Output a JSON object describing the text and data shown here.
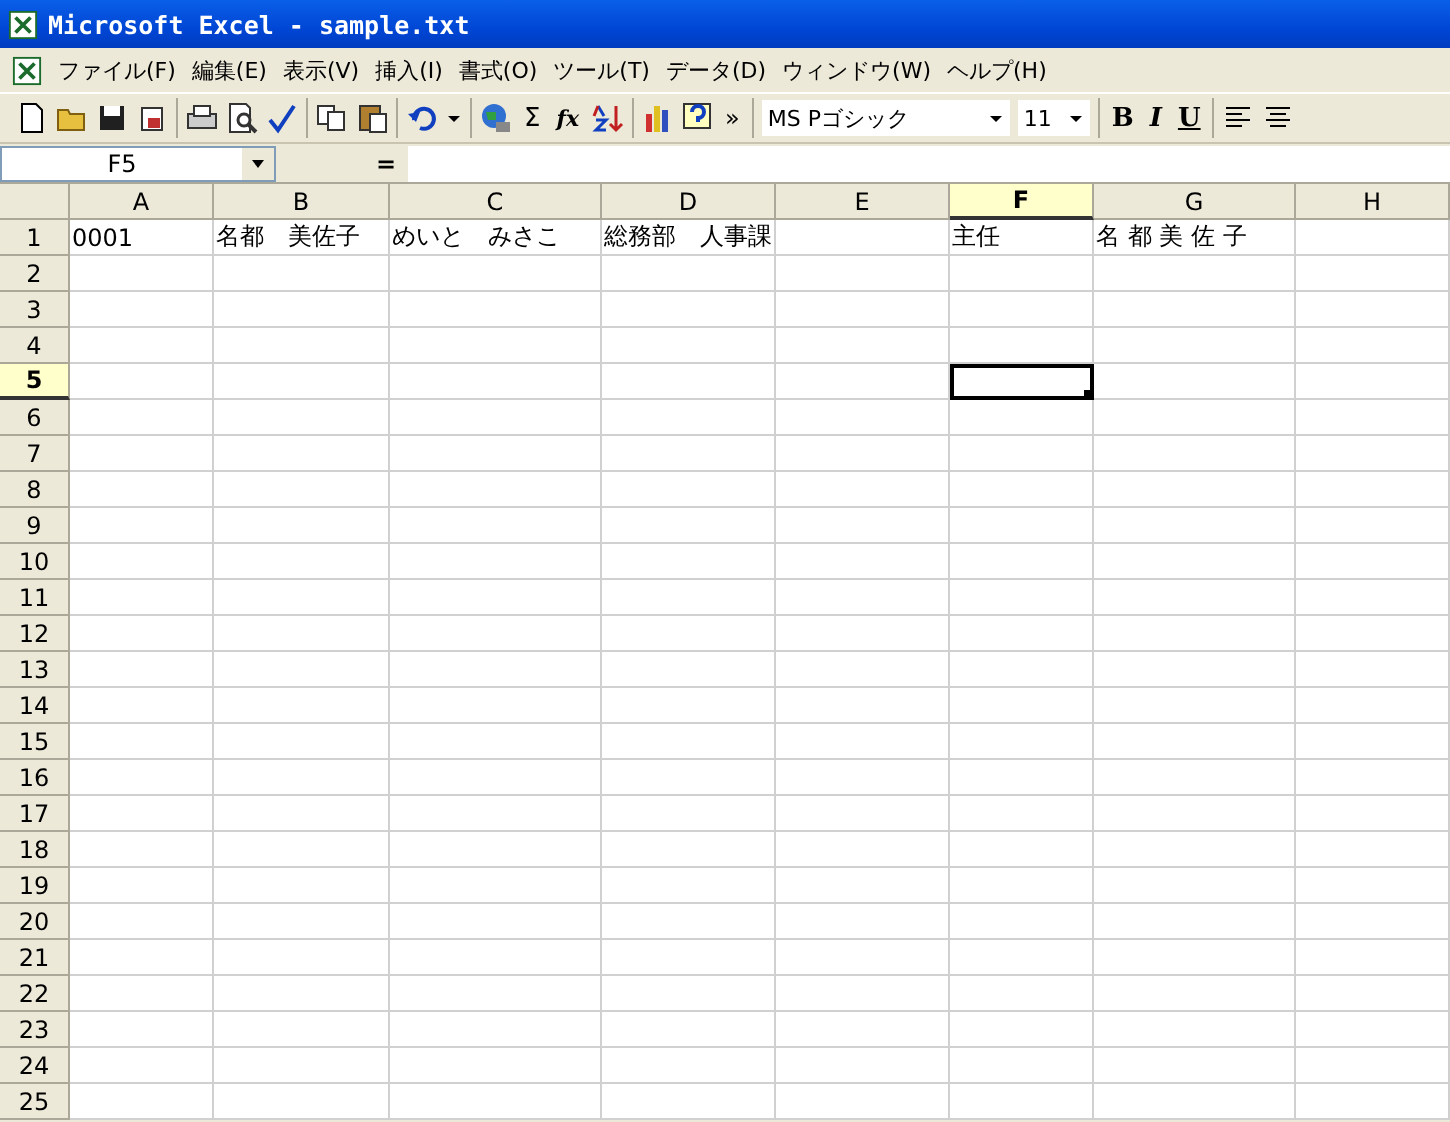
{
  "window": {
    "title": "Microsoft Excel - sample.txt"
  },
  "menu": [
    "ファイル(F)",
    "編集(E)",
    "表示(V)",
    "挿入(I)",
    "書式(O)",
    "ツール(T)",
    "データ(D)",
    "ウィンドウ(W)",
    "ヘルプ(H)"
  ],
  "toolbar": {
    "sum": "Σ",
    "function": "fx",
    "more": "»",
    "font": "MS Pゴシック",
    "size": "11",
    "bold": "B",
    "italic": "I",
    "underline": "U"
  },
  "formula_bar": {
    "name_box": "F5",
    "equals": "="
  },
  "sheet": {
    "columns": [
      {
        "label": "A",
        "selected": false
      },
      {
        "label": "B",
        "selected": false
      },
      {
        "label": "C",
        "selected": false
      },
      {
        "label": "D",
        "selected": false
      },
      {
        "label": "E",
        "selected": false
      },
      {
        "label": "F",
        "selected": true
      },
      {
        "label": "G",
        "selected": false
      },
      {
        "label": "H",
        "selected": false
      }
    ],
    "rows": [
      {
        "header": "1",
        "selected": false,
        "cells": [
          {
            "text": "0001",
            "active": false
          },
          {
            "text": "名都　美佐子",
            "active": false
          },
          {
            "text": "めいと　みさこ",
            "active": false
          },
          {
            "text": "総務部　人事課",
            "active": false
          },
          {
            "active": false
          },
          {
            "text": "主任",
            "active": false
          },
          {
            "text": "名 都 美 佐 子",
            "active": false
          },
          {
            "active": false
          }
        ]
      },
      {
        "header": "2",
        "selected": false
      },
      {
        "header": "3",
        "selected": false
      },
      {
        "header": "4",
        "selected": false
      },
      {
        "header": "5",
        "selected": true,
        "cells": [
          {
            "active": false
          },
          {
            "active": false
          },
          {
            "active": false
          },
          {
            "active": false
          },
          {
            "active": false
          },
          {
            "active": true
          },
          {
            "active": false
          },
          {
            "active": false
          }
        ]
      },
      {
        "header": "6",
        "selected": false
      },
      {
        "header": "7",
        "selected": false
      },
      {
        "header": "8",
        "selected": false
      },
      {
        "header": "9",
        "selected": false
      },
      {
        "header": "10",
        "selected": false
      },
      {
        "header": "11",
        "selected": false
      },
      {
        "header": "12",
        "selected": false
      },
      {
        "header": "13",
        "selected": false
      },
      {
        "header": "14",
        "selected": false
      },
      {
        "header": "15",
        "selected": false
      },
      {
        "header": "16",
        "selected": false
      },
      {
        "header": "17",
        "selected": false
      },
      {
        "header": "18",
        "selected": false
      },
      {
        "header": "19",
        "selected": false
      },
      {
        "header": "20",
        "selected": false
      },
      {
        "header": "21",
        "selected": false
      },
      {
        "header": "22",
        "selected": false
      },
      {
        "header": "23",
        "selected": false
      },
      {
        "header": "24",
        "selected": false
      },
      {
        "header": "25",
        "selected": false
      }
    ]
  }
}
